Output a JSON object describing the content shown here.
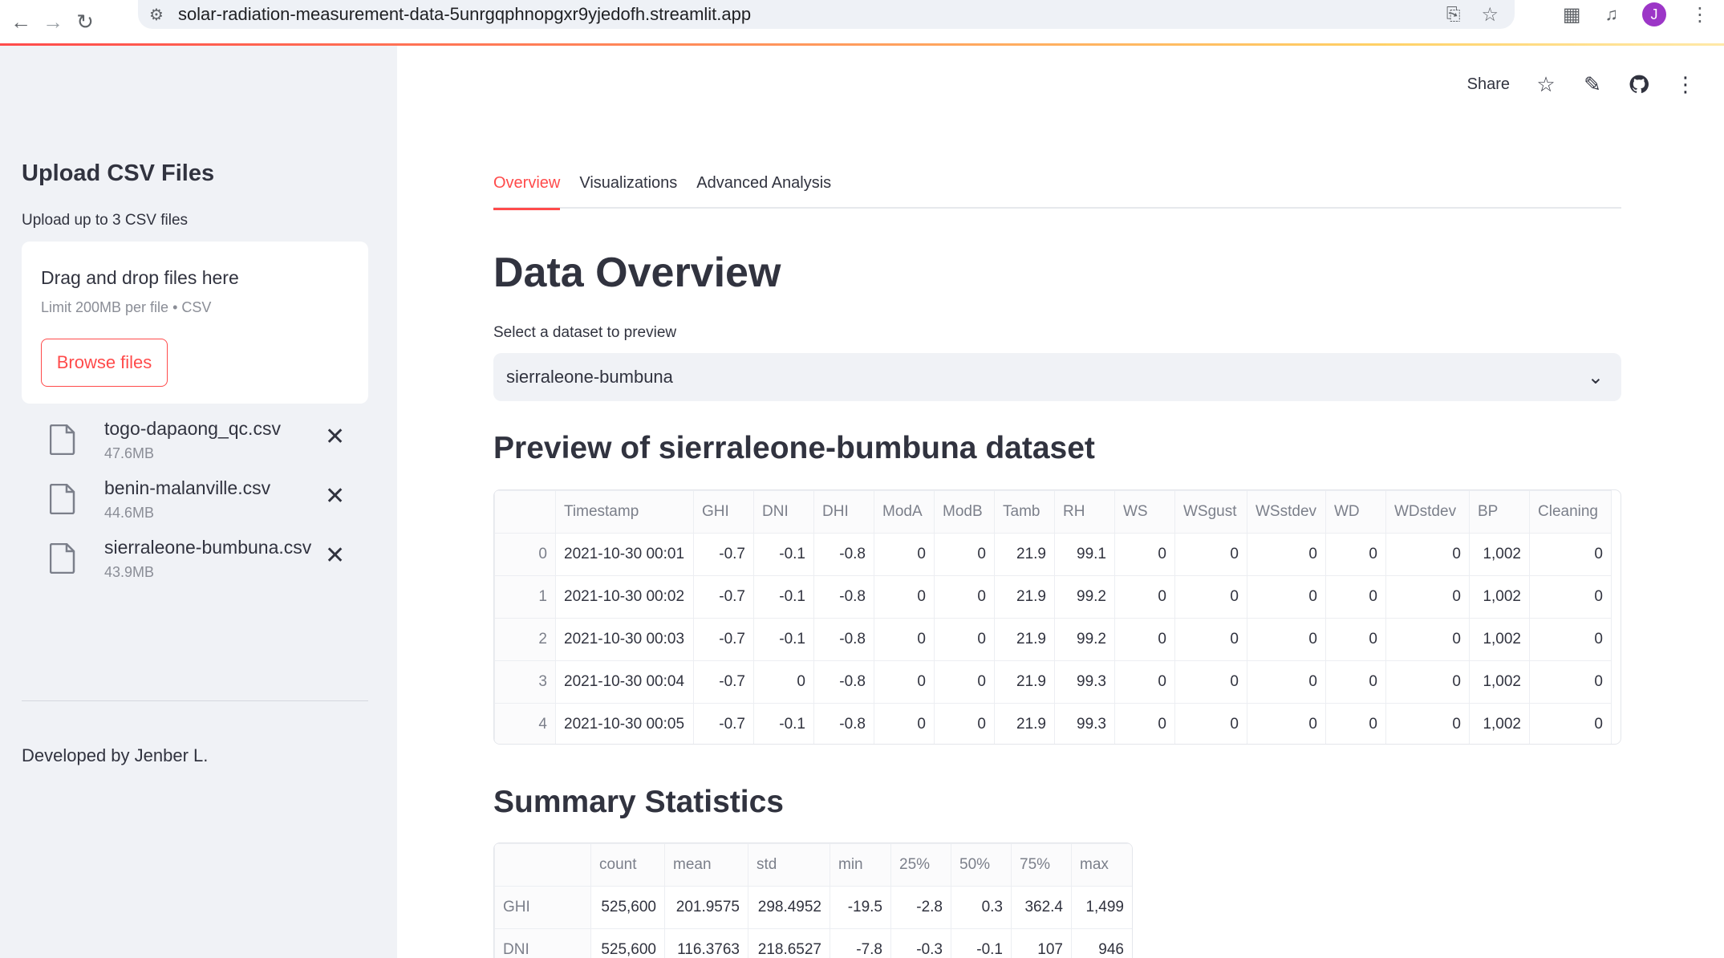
{
  "browser": {
    "url": "solar-radiation-measurement-data-5unrgqphnopgxr9yjedofh.streamlit.app",
    "profile_initial": "J"
  },
  "sidebar": {
    "title": "Upload CSV Files",
    "subtitle": "Upload up to 3 CSV files",
    "dropzone": {
      "title": "Drag and drop files here",
      "limit": "Limit 200MB per file • CSV",
      "button": "Browse files"
    },
    "files": [
      {
        "name": "togo-dapaong_qc.csv",
        "size": "47.6MB"
      },
      {
        "name": "benin-malanville.csv",
        "size": "44.6MB"
      },
      {
        "name": "sierraleone-bumbuna.csv",
        "size": "43.9MB"
      }
    ],
    "footer": "Developed by Jenber L."
  },
  "toolbar": {
    "share": "Share"
  },
  "tabs": [
    "Overview",
    "Visualizations",
    "Advanced Analysis"
  ],
  "main": {
    "title": "Data Overview",
    "select_label": "Select a dataset to preview",
    "select_value": "sierraleone-bumbuna",
    "preview_title": "Preview of sierraleone-bumbuna dataset",
    "summary_title": "Summary Statistics"
  },
  "preview_table": {
    "columns": [
      "",
      "Timestamp",
      "GHI",
      "DNI",
      "DHI",
      "ModA",
      "ModB",
      "Tamb",
      "RH",
      "WS",
      "WSgust",
      "WSstdev",
      "WD",
      "WDstdev",
      "BP",
      "Cleaning"
    ],
    "rows": [
      [
        "0",
        "2021-10-30 00:01",
        "-0.7",
        "-0.1",
        "-0.8",
        "0",
        "0",
        "21.9",
        "99.1",
        "0",
        "0",
        "0",
        "0",
        "0",
        "1,002",
        "0"
      ],
      [
        "1",
        "2021-10-30 00:02",
        "-0.7",
        "-0.1",
        "-0.8",
        "0",
        "0",
        "21.9",
        "99.2",
        "0",
        "0",
        "0",
        "0",
        "0",
        "1,002",
        "0"
      ],
      [
        "2",
        "2021-10-30 00:03",
        "-0.7",
        "-0.1",
        "-0.8",
        "0",
        "0",
        "21.9",
        "99.2",
        "0",
        "0",
        "0",
        "0",
        "0",
        "1,002",
        "0"
      ],
      [
        "3",
        "2021-10-30 00:04",
        "-0.7",
        "0",
        "-0.8",
        "0",
        "0",
        "21.9",
        "99.3",
        "0",
        "0",
        "0",
        "0",
        "0",
        "1,002",
        "0"
      ],
      [
        "4",
        "2021-10-30 00:05",
        "-0.7",
        "-0.1",
        "-0.8",
        "0",
        "0",
        "21.9",
        "99.3",
        "0",
        "0",
        "0",
        "0",
        "0",
        "1,002",
        "0"
      ]
    ]
  },
  "summary_table": {
    "columns": [
      "",
      "count",
      "mean",
      "std",
      "min",
      "25%",
      "50%",
      "75%",
      "max"
    ],
    "rows": [
      [
        "GHI",
        "525,600",
        "201.9575",
        "298.4952",
        "-19.5",
        "-2.8",
        "0.3",
        "362.4",
        "1,499"
      ],
      [
        "DNI",
        "525,600",
        "116.3763",
        "218.6527",
        "-7.8",
        "-0.3",
        "-0.1",
        "107",
        "946"
      ]
    ]
  },
  "colors": {
    "accent": "#ff4b4b",
    "sidebar_bg": "#f0f2f6",
    "text": "#31333f",
    "avatar": "#9c36c7"
  }
}
